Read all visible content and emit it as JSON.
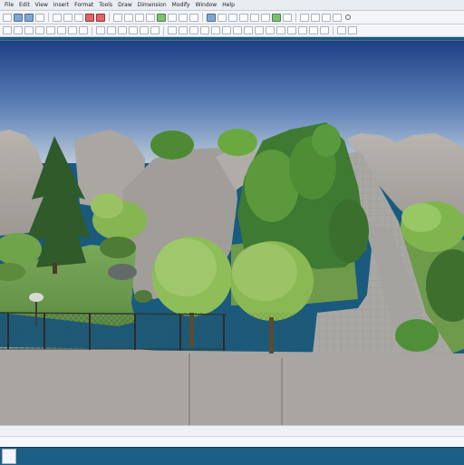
{
  "menubar": {
    "items": [
      "File",
      "Edit",
      "View",
      "Insert",
      "Format",
      "Tools",
      "Draw",
      "Dimension",
      "Modify",
      "Window",
      "Help"
    ],
    "window_title": ""
  },
  "viewport": {
    "scene": "3d-landscape-render",
    "sky_color_top": "#1e3f86",
    "sky_color_bottom": "#b9c9d9",
    "grass_color": "#6b9a4d",
    "paving_color": "#a8a6a2"
  },
  "statusbar": {
    "left": "",
    "center": "",
    "right": ""
  },
  "command_line": {
    "text": ""
  }
}
